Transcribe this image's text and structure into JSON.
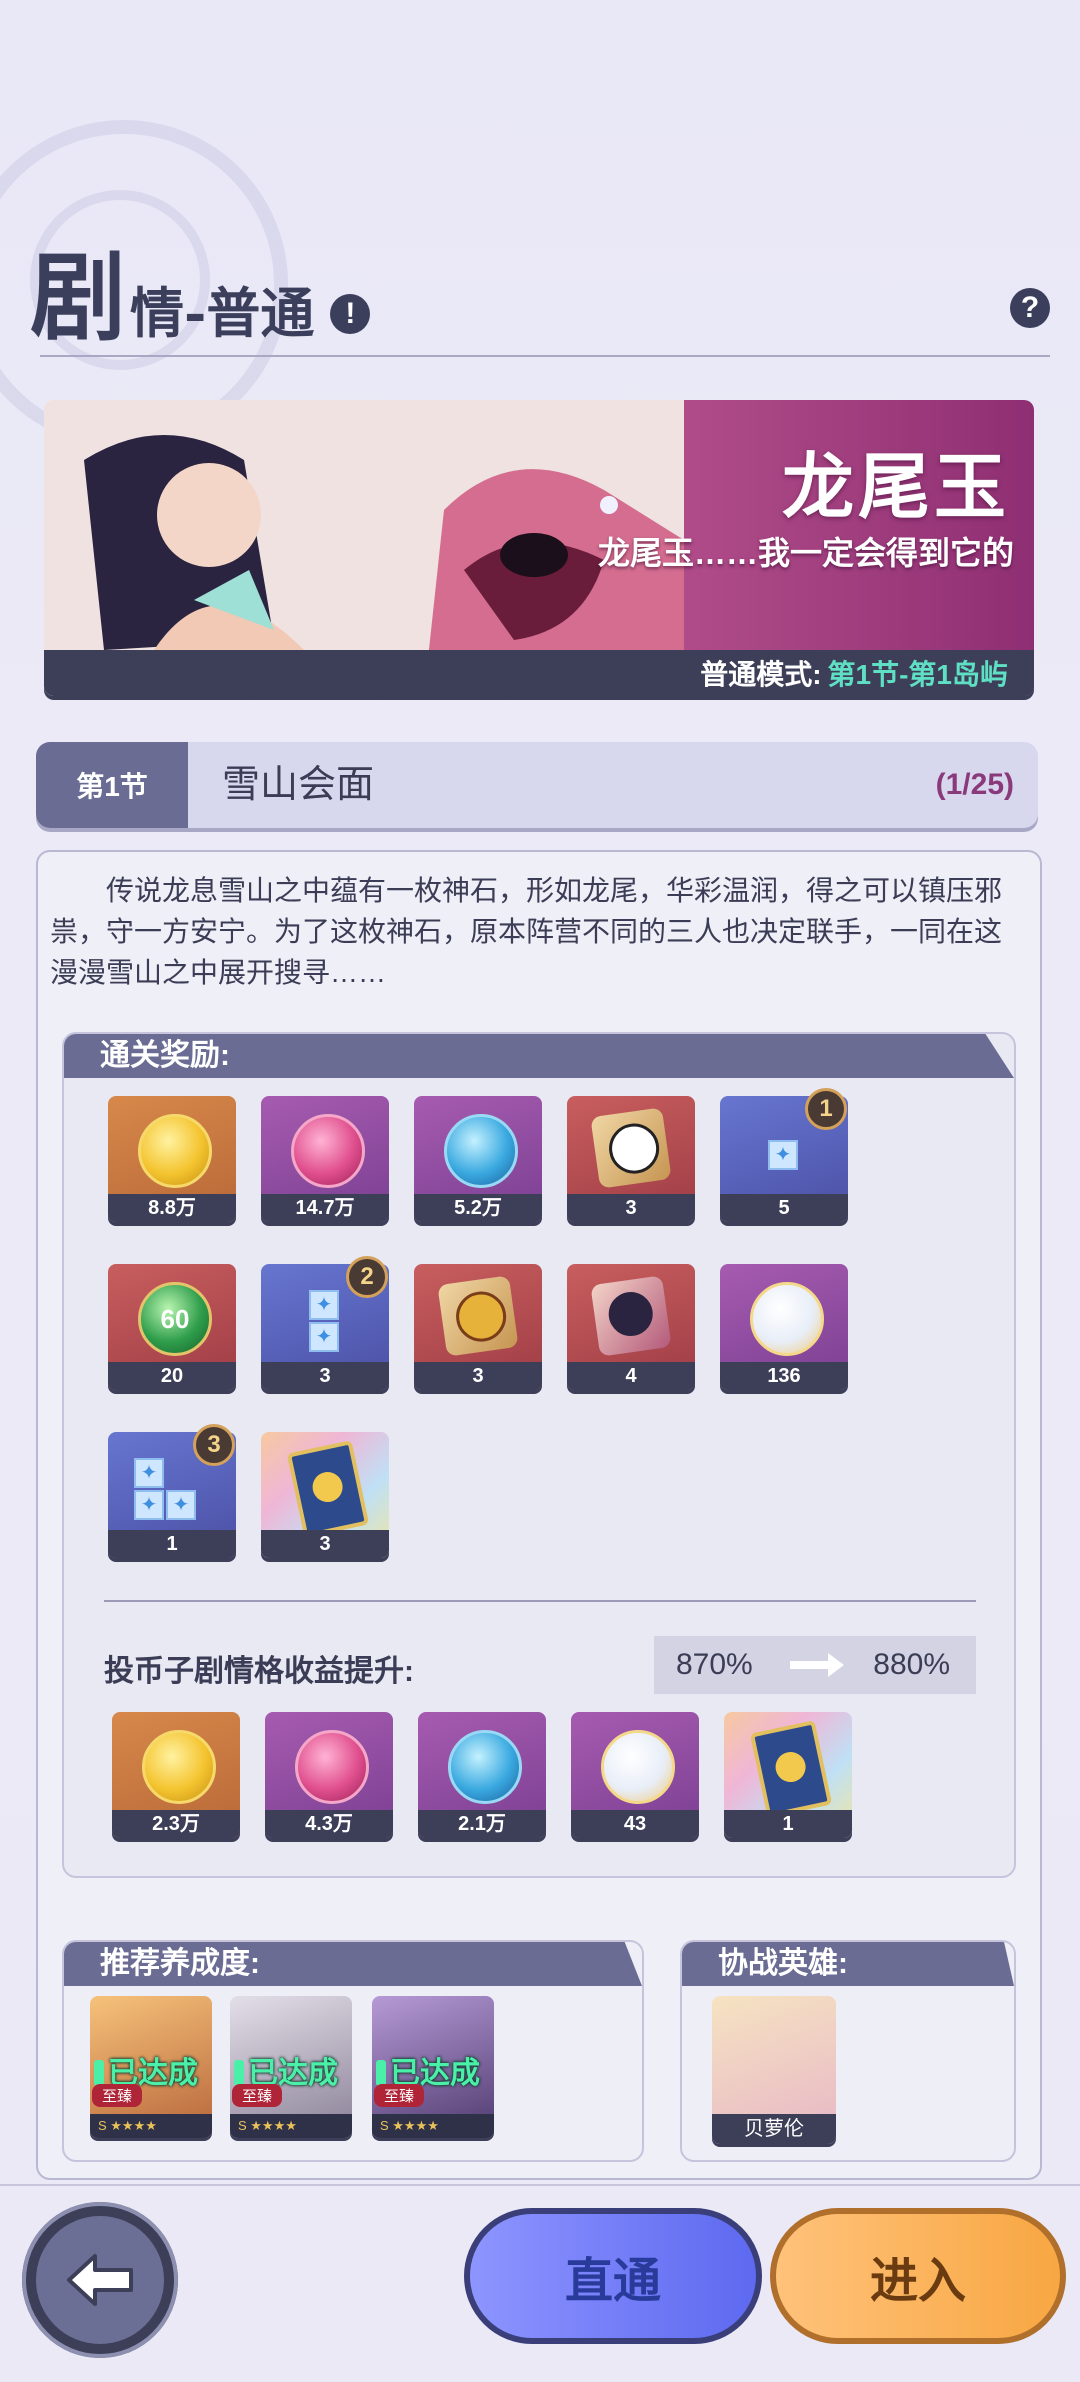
{
  "header": {
    "title_first": "剧",
    "title_rest": "情-普通"
  },
  "banner": {
    "name": "龙尾玉",
    "quote": "龙尾玉……我一定会得到它的",
    "mode_label": "普通模式:",
    "mode_value": "第1节-第1岛屿"
  },
  "chapter": {
    "tag": "第1节",
    "title": "雪山会面",
    "progress": "(1/25)"
  },
  "story": "传说龙息雪山之中蕴有一枚神石，形如龙尾，华彩温润，得之可以镇压邪祟，守一方安宁。为了这枚神石，原本阵营不同的三人也决定联手，一同在这漫漫雪山之中展开搜寻……",
  "rewards": {
    "heading": "通关奖励:",
    "items": [
      {
        "icon": "gold-coin-icon",
        "count": "8.8万"
      },
      {
        "icon": "pink-orb-icon",
        "count": "14.7万"
      },
      {
        "icon": "blue-orb-icon",
        "count": "5.2万"
      },
      {
        "icon": "puzzle-piece-icon",
        "count": "3"
      },
      {
        "icon": "star-tile-1-icon",
        "count": "5",
        "badge": "1"
      },
      {
        "icon": "green-token-icon",
        "count": "20",
        "label": "60"
      },
      {
        "icon": "star-tile-2-icon",
        "count": "3",
        "badge": "2"
      },
      {
        "icon": "puzzle-piece-icon",
        "count": "3"
      },
      {
        "icon": "puzzle-piece-icon",
        "count": "4"
      },
      {
        "icon": "white-crystal-icon",
        "count": "136"
      },
      {
        "icon": "star-tile-3-icon",
        "count": "1",
        "badge": "3"
      },
      {
        "icon": "card-pack-icon",
        "count": "3"
      }
    ]
  },
  "bonus": {
    "label": "投币子剧情格收益提升:",
    "from": "870%",
    "to": "880%",
    "items": [
      {
        "icon": "gold-coin-icon",
        "count": "2.3万"
      },
      {
        "icon": "pink-orb-icon",
        "count": "4.3万"
      },
      {
        "icon": "blue-orb-icon",
        "count": "2.1万"
      },
      {
        "icon": "white-crystal-icon",
        "count": "43"
      },
      {
        "icon": "card-pack-icon",
        "count": "1"
      }
    ]
  },
  "recommend": {
    "heading": "推荐养成度:",
    "heroes": [
      {
        "status": "已达成",
        "rank": "至臻",
        "grade": "S ★★★★"
      },
      {
        "status": "已达成",
        "rank": "至臻",
        "grade": "S ★★★★"
      },
      {
        "status": "已达成",
        "rank": "至臻",
        "grade": "S ★★★★"
      }
    ]
  },
  "assist": {
    "heading": "协战英雄:",
    "hero_name": "贝萝伦"
  },
  "buttons": {
    "direct": "直通",
    "enter": "进入"
  },
  "colors": {
    "accent_dark": "#3d3f58",
    "panel_header": "#6a6c94",
    "mode_highlight": "#5fe0c4",
    "achieved": "#4af0a8",
    "direct_button": "#6f7af5",
    "enter_button": "#f9b35a"
  }
}
